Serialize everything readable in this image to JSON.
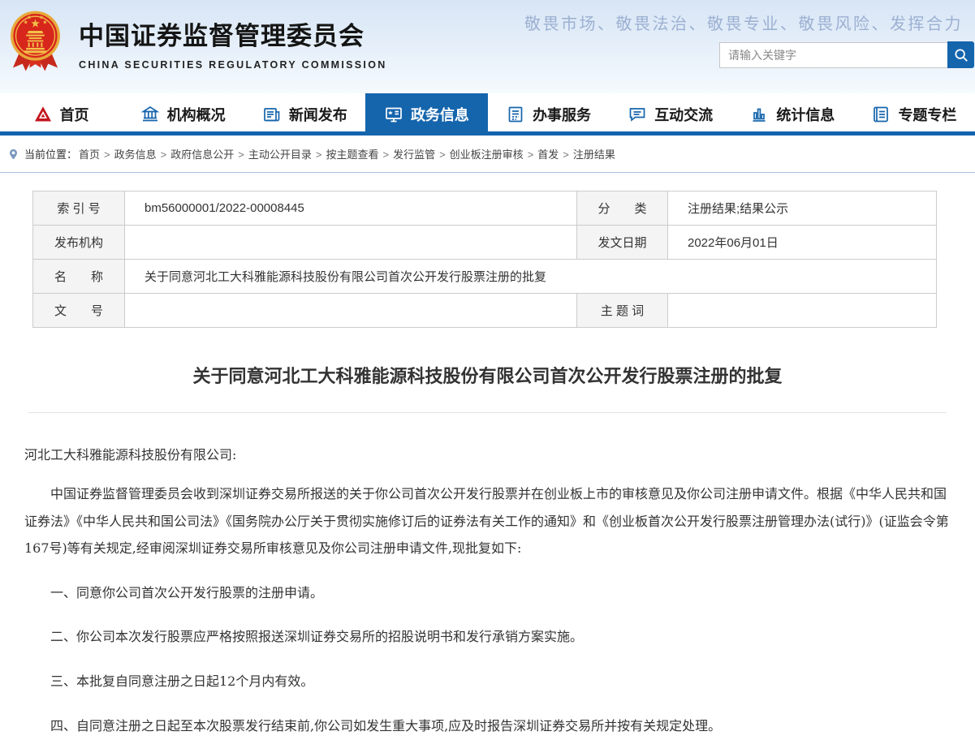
{
  "header": {
    "site_title_cn": "中国证券监督管理委员会",
    "site_title_en": "CHINA SECURITIES REGULATORY COMMISSION",
    "slogan": "敬畏市场、敬畏法治、敬畏专业、敬畏风险、发挥合力",
    "search": {
      "placeholder": "请输入关键字"
    }
  },
  "nav": {
    "items": [
      {
        "name": "home",
        "label": "首页",
        "icon": "csrc-logo-icon",
        "active": false
      },
      {
        "name": "about",
        "label": "机构概况",
        "icon": "bank-icon",
        "active": false
      },
      {
        "name": "news",
        "label": "新闻发布",
        "icon": "newspaper-icon",
        "active": false
      },
      {
        "name": "gov-info",
        "label": "政务信息",
        "icon": "monitor-icon",
        "active": true
      },
      {
        "name": "services",
        "label": "办事服务",
        "icon": "services-icon",
        "active": false
      },
      {
        "name": "interaction",
        "label": "互动交流",
        "icon": "chat-icon",
        "active": false
      },
      {
        "name": "statistics",
        "label": "统计信息",
        "icon": "bar-chart-icon",
        "active": false
      },
      {
        "name": "topics",
        "label": "专题专栏",
        "icon": "topic-icon",
        "active": false
      }
    ]
  },
  "breadcrumb": {
    "label": "当前位置：",
    "separator": ">",
    "items": [
      "首页",
      "政务信息",
      "政府信息公开",
      "主动公开目录",
      "按主题查看",
      "发行监管",
      "创业板注册审核",
      "首发",
      "注册结果"
    ]
  },
  "meta_table": {
    "index_label": "索 引 号",
    "index_value": "bm56000001/2022-00008445",
    "category_label": "分　　类",
    "category_value": "注册结果;结果公示",
    "agency_label": "发布机构",
    "agency_value": "",
    "date_label": "发文日期",
    "date_value": "2022年06月01日",
    "name_label": "名　　称",
    "name_value": "关于同意河北工大科雅能源科技股份有限公司首次公开发行股票注册的批复",
    "docnum_label": "文　　号",
    "docnum_value": "",
    "subject_label": "主 题 词",
    "subject_value": ""
  },
  "document": {
    "title": "关于同意河北工大科雅能源科技股份有限公司首次公开发行股票注册的批复",
    "salutation": "河北工大科雅能源科技股份有限公司:",
    "paragraphs": [
      "中国证券监督管理委员会收到深圳证券交易所报送的关于你公司首次公开发行股票并在创业板上市的审核意见及你公司注册申请文件。根据《中华人民共和国证券法》《中华人民共和国公司法》《国务院办公厅关于贯彻实施修订后的证券法有关工作的通知》和《创业板首次公开发行股票注册管理办法(试行)》(证监会令第167号)等有关规定,经审阅深圳证券交易所审核意见及你公司注册申请文件,现批复如下:",
      "一、同意你公司首次公开发行股票的注册申请。",
      "二、你公司本次发行股票应严格按照报送深圳证券交易所的招股说明书和发行承销方案实施。",
      "三、本批复自同意注册之日起12个月内有效。",
      "四、自同意注册之日起至本次股票发行结束前,你公司如发生重大事项,应及时报告深圳证券交易所并按有关规定处理。"
    ]
  },
  "colors": {
    "accent_blue": "#1565ad",
    "nav_border_blue": "#1463ae",
    "emblem_red": "#d7261b",
    "emblem_gold": "#eeb42c",
    "slogan_blue": "#9cb0d2",
    "table_border": "#cccccc",
    "label_cell_bg": "#f4f4f4",
    "body_text": "#333333"
  }
}
